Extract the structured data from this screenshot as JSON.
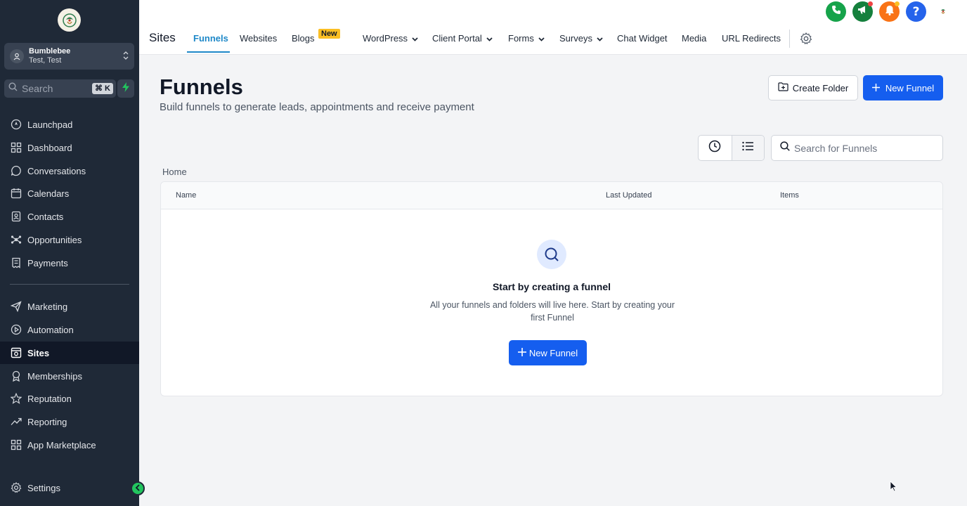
{
  "sidebar": {
    "account": {
      "name": "Bumblebee",
      "location": "Test, Test"
    },
    "search": {
      "label": "Search",
      "shortcut": "⌘ K"
    },
    "items": [
      {
        "label": "Launchpad",
        "icon": "rocket-icon"
      },
      {
        "label": "Dashboard",
        "icon": "grid-icon"
      },
      {
        "label": "Conversations",
        "icon": "chat-bubble-icon"
      },
      {
        "label": "Calendars",
        "icon": "calendar-icon"
      },
      {
        "label": "Contacts",
        "icon": "address-book-icon"
      },
      {
        "label": "Opportunities",
        "icon": "network-icon"
      },
      {
        "label": "Payments",
        "icon": "receipt-icon"
      },
      {
        "label": "Marketing",
        "icon": "send-icon"
      },
      {
        "label": "Automation",
        "icon": "automation-icon"
      },
      {
        "label": "Sites",
        "icon": "sites-icon",
        "active": true
      },
      {
        "label": "Memberships",
        "icon": "award-icon"
      },
      {
        "label": "Reputation",
        "icon": "star-icon"
      },
      {
        "label": "Reporting",
        "icon": "trend-icon"
      },
      {
        "label": "App Marketplace",
        "icon": "apps-icon"
      },
      {
        "label": "Settings",
        "icon": "gear-icon"
      }
    ]
  },
  "header": {
    "section": "Sites",
    "tabs": [
      {
        "label": "Funnels",
        "active": true
      },
      {
        "label": "Websites"
      },
      {
        "label": "Blogs",
        "badge": "New"
      },
      {
        "label": "WordPress",
        "dropdown": true
      },
      {
        "label": "Client Portal",
        "dropdown": true
      },
      {
        "label": "Forms",
        "dropdown": true
      },
      {
        "label": "Surveys",
        "dropdown": true
      },
      {
        "label": "Chat Widget"
      },
      {
        "label": "Media"
      },
      {
        "label": "URL Redirects"
      }
    ]
  },
  "main": {
    "title": "Funnels",
    "subtitle": "Build funnels to generate leads, appointments and receive payment",
    "create_folder_label": "Create Folder",
    "new_funnel_label": "New Funnel",
    "search_placeholder": "Search for Funnels",
    "breadcrumb": "Home",
    "table": {
      "columns": [
        "Name",
        "Last Updated",
        "Items"
      ]
    },
    "empty_state": {
      "title": "Start by creating a funnel",
      "description": "All your funnels and folders will live here. Start by creating your first Funnel",
      "button_label": "New Funnel"
    }
  },
  "colors": {
    "sidebar_bg": "#1f2937",
    "accent_blue": "#155eef",
    "tab_active": "#1e88c8",
    "badge": "#fbbf24",
    "phone": "#16a34a",
    "announce": "#15803d",
    "bell": "#f97316",
    "help": "#2563eb"
  }
}
